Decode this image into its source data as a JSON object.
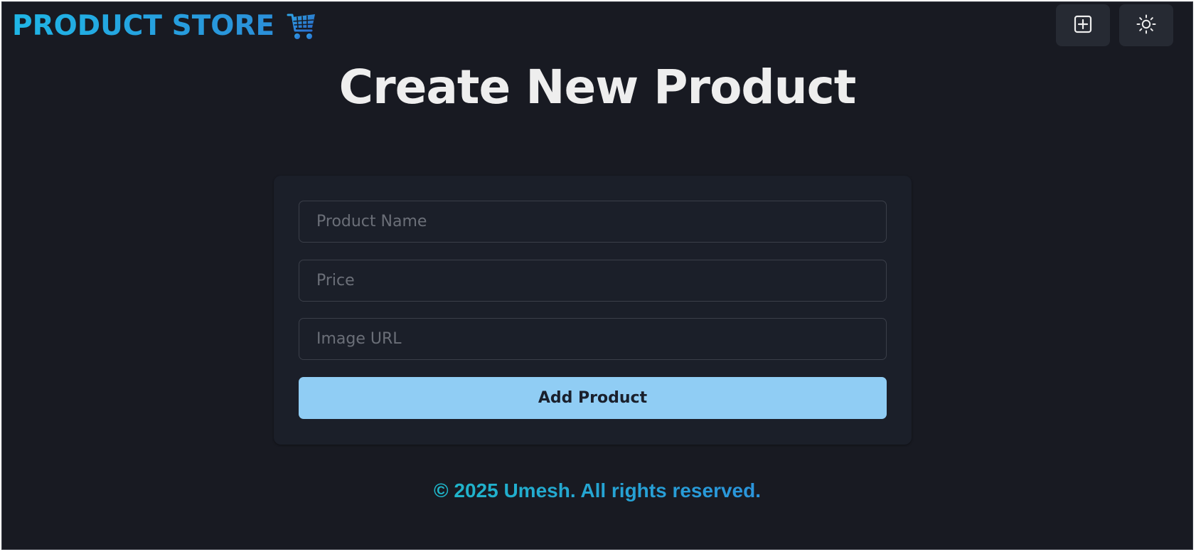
{
  "navbar": {
    "brand_text": "PRODUCT STORE",
    "brand_icon": "shopping-cart-icon",
    "create_icon": "plus-square-icon",
    "theme_icon": "sun-icon"
  },
  "main": {
    "title": "Create New Product",
    "form": {
      "name_placeholder": "Product Name",
      "price_placeholder": "Price",
      "image_placeholder": "Image URL",
      "submit_label": "Add Product"
    }
  },
  "footer": {
    "text": "© 2025 Umesh. All rights reserved."
  },
  "colors": {
    "background": "#181a22",
    "card": "#1b1f29",
    "accent_button": "#90cdf4",
    "brand_gradient_start": "#1fb6e6",
    "brand_gradient_end": "#2b8fd9",
    "title_text": "#eeeeee"
  }
}
